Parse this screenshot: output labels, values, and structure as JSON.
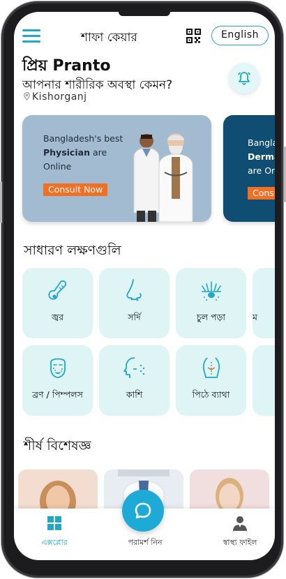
{
  "header": {
    "app_title": "শাফা কেয়ার",
    "language_button": "English"
  },
  "greeting": {
    "title": "প্রিয় Pranto",
    "question": "আপনার শারীরিক অবস্থা কেমন?",
    "location": "Kishorganj"
  },
  "banners": [
    {
      "line1": "Bangladesh's best",
      "line2_bold": "Physician",
      "line2_rest": " are",
      "line3": "Online",
      "cta": "Consult Now",
      "bg": "#a3bbd1"
    },
    {
      "line1": "Banglad",
      "line2_bold": "Dermat",
      "line3": "are Onl",
      "cta": "Consu",
      "bg": "#0f4d72"
    }
  ],
  "symptoms": {
    "title": "সাধারণ লক্ষণগুলি",
    "items": [
      {
        "label": "জ্বর",
        "icon": "thermometer-icon"
      },
      {
        "label": "সর্দি",
        "icon": "nose-icon"
      },
      {
        "label": "চুল পড়া",
        "icon": "hair-follicle-icon"
      },
      {
        "label": "ম",
        "icon": "partial-icon"
      },
      {
        "label": "ব্রণ / পিম্পলস",
        "icon": "face-acne-icon"
      },
      {
        "label": "কাশি",
        "icon": "cough-icon"
      },
      {
        "label": "পিঠে ব্যাথা",
        "icon": "back-pain-icon"
      },
      {
        "label": "",
        "icon": "partial-icon"
      }
    ]
  },
  "specialists": {
    "title": "শীর্ষ বিশেষজ্ঞ"
  },
  "bottom_nav": {
    "explore": "এক্সপ্লোর",
    "consult": "পরামর্শ নিন",
    "health_file": "স্বাস্থ্য ফাইল"
  },
  "colors": {
    "accent": "#22a7c7",
    "card_bg": "#dff4f5",
    "cta": "#f36f21"
  }
}
